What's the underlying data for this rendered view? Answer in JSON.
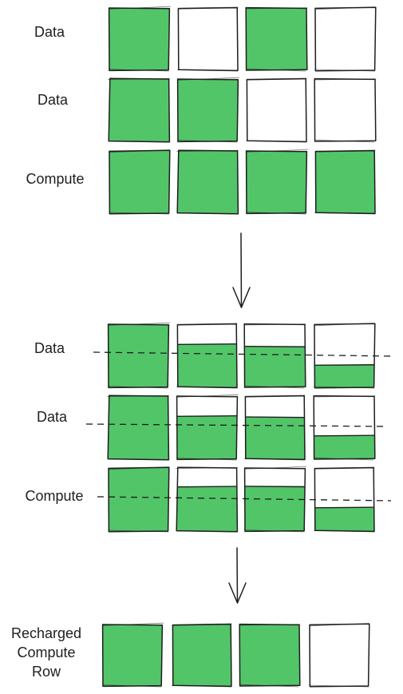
{
  "colors": {
    "fill": "#52c569",
    "stroke": "#1e1e1e",
    "empty": "#ffffff"
  },
  "sections": [
    {
      "id": "initial",
      "rows": [
        {
          "label": "Data",
          "cells": [
            1,
            0,
            1,
            0
          ]
        },
        {
          "label": "Data",
          "cells": [
            1,
            1,
            0,
            0
          ]
        },
        {
          "label": "Compute",
          "cells": [
            1,
            1,
            1,
            1
          ]
        }
      ]
    },
    {
      "id": "balanced",
      "rows": [
        {
          "label": "Data",
          "cells": [
            1,
            0.68,
            0.65,
            0.35
          ]
        },
        {
          "label": "Data",
          "cells": [
            1,
            0.68,
            0.67,
            0.37
          ]
        },
        {
          "label": "Compute",
          "cells": [
            1,
            0.7,
            0.71,
            0.37
          ]
        }
      ]
    },
    {
      "id": "recharged",
      "rows": [
        {
          "label_lines": [
            "Recharged",
            "Compute",
            "Row"
          ],
          "cells": [
            1,
            1,
            1,
            0
          ]
        }
      ]
    }
  ],
  "arrows": [
    {
      "from": "initial",
      "to": "balanced"
    },
    {
      "from": "balanced",
      "to": "recharged"
    }
  ]
}
